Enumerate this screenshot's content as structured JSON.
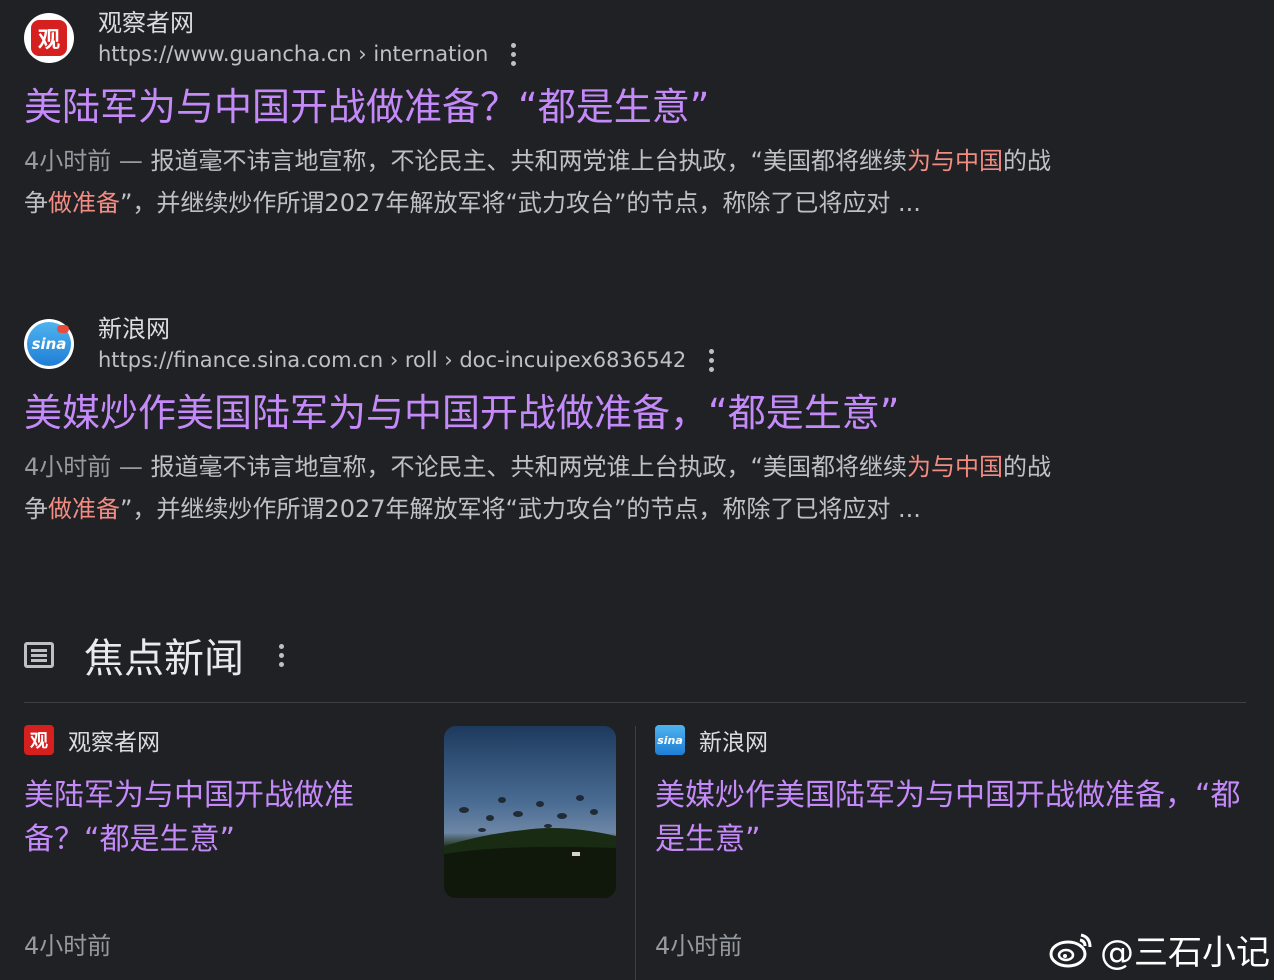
{
  "results": [
    {
      "site_name": "观察者网",
      "url": "https://www.guancha.cn › internation",
      "favicon_icon": "guancha-icon",
      "title": "美陆军为与中国开战做准备？“都是生意”",
      "date": "4小时前 — ",
      "snippet_line1_a": "报道毫不讳言地宣称，不论民主、共和两党谁上台执政，“美国都将继续",
      "snippet_line1_hl": "为与中国",
      "snippet_line1_b": "的战",
      "snippet_line2_a": "争",
      "snippet_line2_hl": "做准备",
      "snippet_line2_b": "”，并继续炒作所谓2027年解放军将“武力攻台”的节点，称除了已将应对 ..."
    },
    {
      "site_name": "新浪网",
      "url": "https://finance.sina.com.cn › roll › doc-incuipex6836542",
      "favicon_icon": "sina-icon",
      "title": "美媒炒作美国陆军为与中国开战做准备，“都是生意”",
      "date": "4小时前 — ",
      "snippet_line1_a": "报道毫不讳言地宣称，不论民主、共和两党谁上台执政，“美国都将继续",
      "snippet_line1_hl": "为与中国",
      "snippet_line1_b": "的战",
      "snippet_line2_a": "争",
      "snippet_line2_hl": "做准备",
      "snippet_line2_b": "”，并继续炒作所谓2027年解放军将“武力攻台”的节点，称除了已将应对 ..."
    }
  ],
  "top_stories": {
    "title": "焦点新闻",
    "icon": "newspaper-icon",
    "cards": [
      {
        "source": "观察者网",
        "title": "美陆军为与中国开战做准备？“都是生意”",
        "time": "4小时前"
      },
      {
        "source": "新浪网",
        "title": "美媒炒作美国陆军为与中国开战做准备，“都是生意”",
        "time": "4小时前"
      }
    ]
  },
  "favicon_letters": {
    "guancha": "观",
    "sina": "sina"
  },
  "watermark": "@三石小记",
  "colors": {
    "background": "#202124",
    "title_link": "#c58af9",
    "highlight": "#f28b82",
    "text": "#bdc1c6"
  }
}
